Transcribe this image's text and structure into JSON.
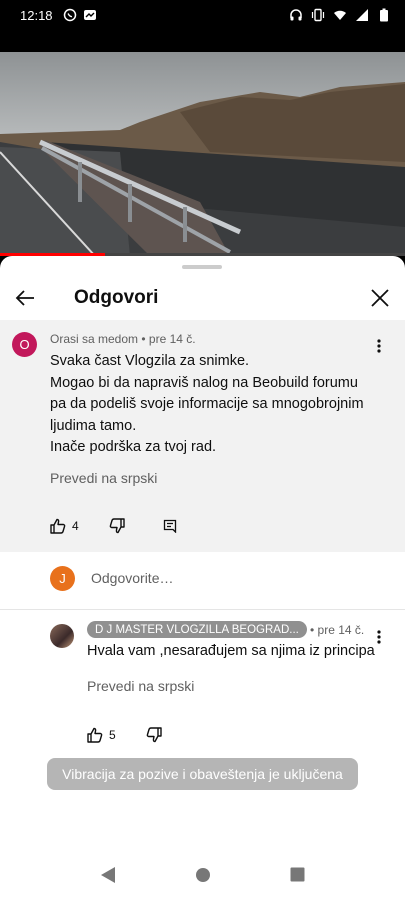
{
  "status_bar": {
    "time": "12:18",
    "left_icons": [
      "viber-icon",
      "messenger-icon"
    ],
    "right_icons": [
      "headphones-icon",
      "vibrate-icon",
      "wifi-icon",
      "signal-icon",
      "battery-icon"
    ]
  },
  "video": {
    "progress_fraction": 0.26,
    "colors": {
      "progress": "#ff0000"
    }
  },
  "header": {
    "title": "Odgovori"
  },
  "main_comment": {
    "avatar_letter": "O",
    "author": "Orasi sa medom",
    "time": "pre 14 č.",
    "lines": [
      "Svaka čast Vlogzila za snimke.",
      "Mogao bi da napraviš nalog na Beobuild forumu",
      "pa da podeliš svoje informacije sa mnogobrojnim",
      "ljudima tamo.",
      "Inače podrška za tvoj rad."
    ],
    "translate": "Prevedi na srpski",
    "likes": "4"
  },
  "reply_input": {
    "avatar_letter": "J",
    "placeholder": "Odgovorite…"
  },
  "reply": {
    "author": "D J MASTER VLOGZILLA BEOGRAD...",
    "time": "• pre 14 č.",
    "text": "Hvala vam ,nesarađujem sa njima iz principa",
    "translate": "Prevedi na srpski",
    "likes": "5"
  },
  "toast": {
    "text": "Vibracija za pozive i obaveštenja je uključena"
  }
}
